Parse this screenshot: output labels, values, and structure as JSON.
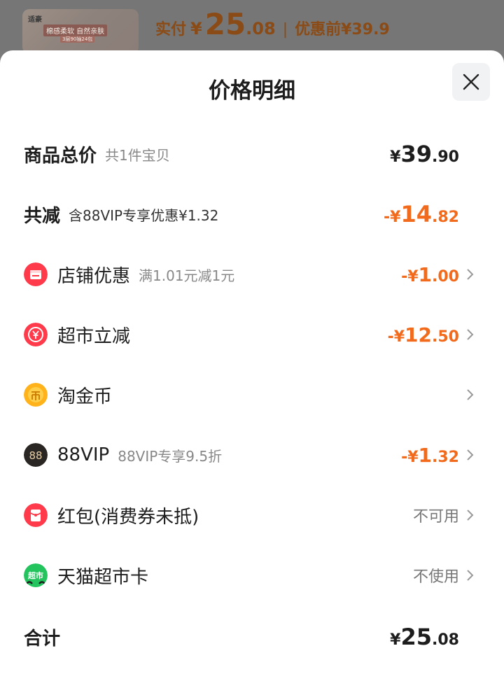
{
  "header": {
    "thumb_brand": "适豪",
    "thumb_slogan": "棉感柔软 自然亲肤",
    "thumb_sub": "3层90抽24包",
    "paid_label": "实付",
    "paid_yen": "¥",
    "paid_int": "25",
    "paid_dec": ".08",
    "separator": "|",
    "before_label": "优惠前¥39.9"
  },
  "sheet": {
    "title": "价格明细",
    "close_icon": "close-icon"
  },
  "summary": {
    "total": {
      "label": "商品总价",
      "sub": "共1件宝贝",
      "sym": "¥",
      "int": "39",
      "dec": ".90"
    },
    "discount": {
      "label": "共减",
      "sub": "含88VIP专享优惠¥1.32",
      "sym": "-¥",
      "int": "14",
      "dec": ".82"
    }
  },
  "items": [
    {
      "icon": "store-coupon-icon",
      "label": "店铺优惠",
      "sub": "满1.01元减1元",
      "sym": "-¥",
      "int": "1",
      "dec": ".00"
    },
    {
      "icon": "supermarket-discount-icon",
      "label": "超市立减",
      "sub": "",
      "sym": "-¥",
      "int": "12",
      "dec": ".50"
    },
    {
      "icon": "taojin-coin-icon",
      "label": "淘金币",
      "sub": ""
    },
    {
      "icon": "88vip-icon",
      "label": "88VIP",
      "sub": "88VIP专享9.5折",
      "sym": "-¥",
      "int": "1",
      "dec": ".32"
    },
    {
      "icon": "red-packet-icon",
      "label": "红包(消费券未抵)",
      "status": "不可用"
    },
    {
      "icon": "tmall-supermarket-card-icon",
      "label": "天猫超市卡",
      "status": "不使用"
    }
  ],
  "footer": {
    "label": "合计",
    "sym": "¥",
    "int": "25",
    "dec": ".08"
  },
  "colors": {
    "accent": "#f26a1b",
    "text": "#1d1d1d",
    "muted": "#888888"
  }
}
